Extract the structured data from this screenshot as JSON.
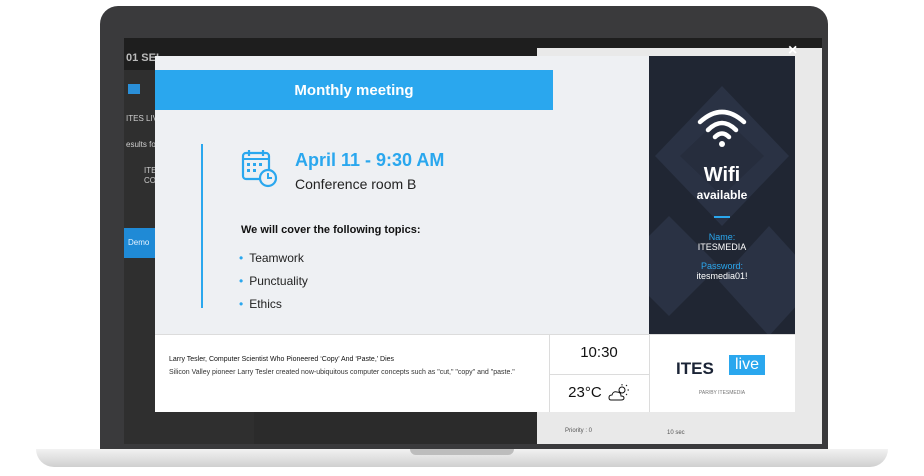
{
  "background_app": {
    "header_fragment": "01 SEL",
    "sidebar_fragments": [
      "ITES LIVE",
      "esults fo",
      "ITES",
      "CO",
      "Demo"
    ],
    "bottom_fragments": [
      "Priority : 0",
      "10 sec"
    ]
  },
  "slide": {
    "title": "Monthly meeting",
    "date_time": "April 11 - 9:30 AM",
    "location": "Conference room B",
    "topics_heading": "We will cover the following topics:",
    "topics": [
      "Teamwork",
      "Punctuality",
      "Ethics"
    ]
  },
  "wifi": {
    "title": "Wifi",
    "subtitle": "available",
    "name_label": "Name:",
    "name_value": "ITESMEDIA",
    "password_label": "Password:",
    "password_value": "itesmedia01!"
  },
  "news": {
    "headline": "Larry Tesler, Computer Scientist Who Pioneered ‘Copy’ And ‘Paste,’ Dies",
    "body": "Silicon Valley pioneer Larry Tesler created now-ubiquitous computer concepts such as \"cut,\" \"copy\" and \"paste.\""
  },
  "widgets": {
    "time": "10:30",
    "temperature": "23°C",
    "weather_icon": "partly-cloudy-icon"
  },
  "logo": {
    "brand_left": "ITES",
    "brand_right": "live",
    "tagline": "PAR/BY ITESMEDIA"
  },
  "modal": {
    "close_label": "×"
  },
  "colors": {
    "accent": "#2aa7ee",
    "dark_panel": "#202633",
    "laptop_frame": "#3a3a3c"
  }
}
